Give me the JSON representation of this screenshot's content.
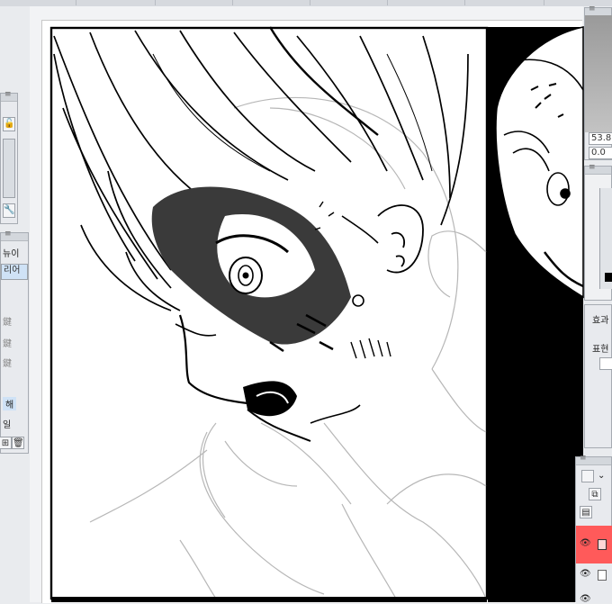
{
  "top_tabs": [
    "",
    "",
    "",
    "",
    "",
    "",
    "",
    ""
  ],
  "left_panel": {
    "menu_label": "뉴이",
    "tab_label": "리어",
    "tool_items": [
      "鍵",
      "鍵",
      "鍵",
      "",
      "해",
      "일"
    ]
  },
  "right_panel": {
    "value_1": "53.8",
    "value_2": "0.0",
    "section_1": "효과",
    "section_2": "표현"
  },
  "colors": {
    "canvas": "#ffffff",
    "ui_panel": "#e8eaee",
    "layer_selected": "#ff5a5a",
    "selection_blue": "#cfe2f6"
  },
  "icons": [
    "lock-icon",
    "wrench-icon",
    "duplicate-layer-icon",
    "trash-icon",
    "eye-icon",
    "menu-icon"
  ]
}
